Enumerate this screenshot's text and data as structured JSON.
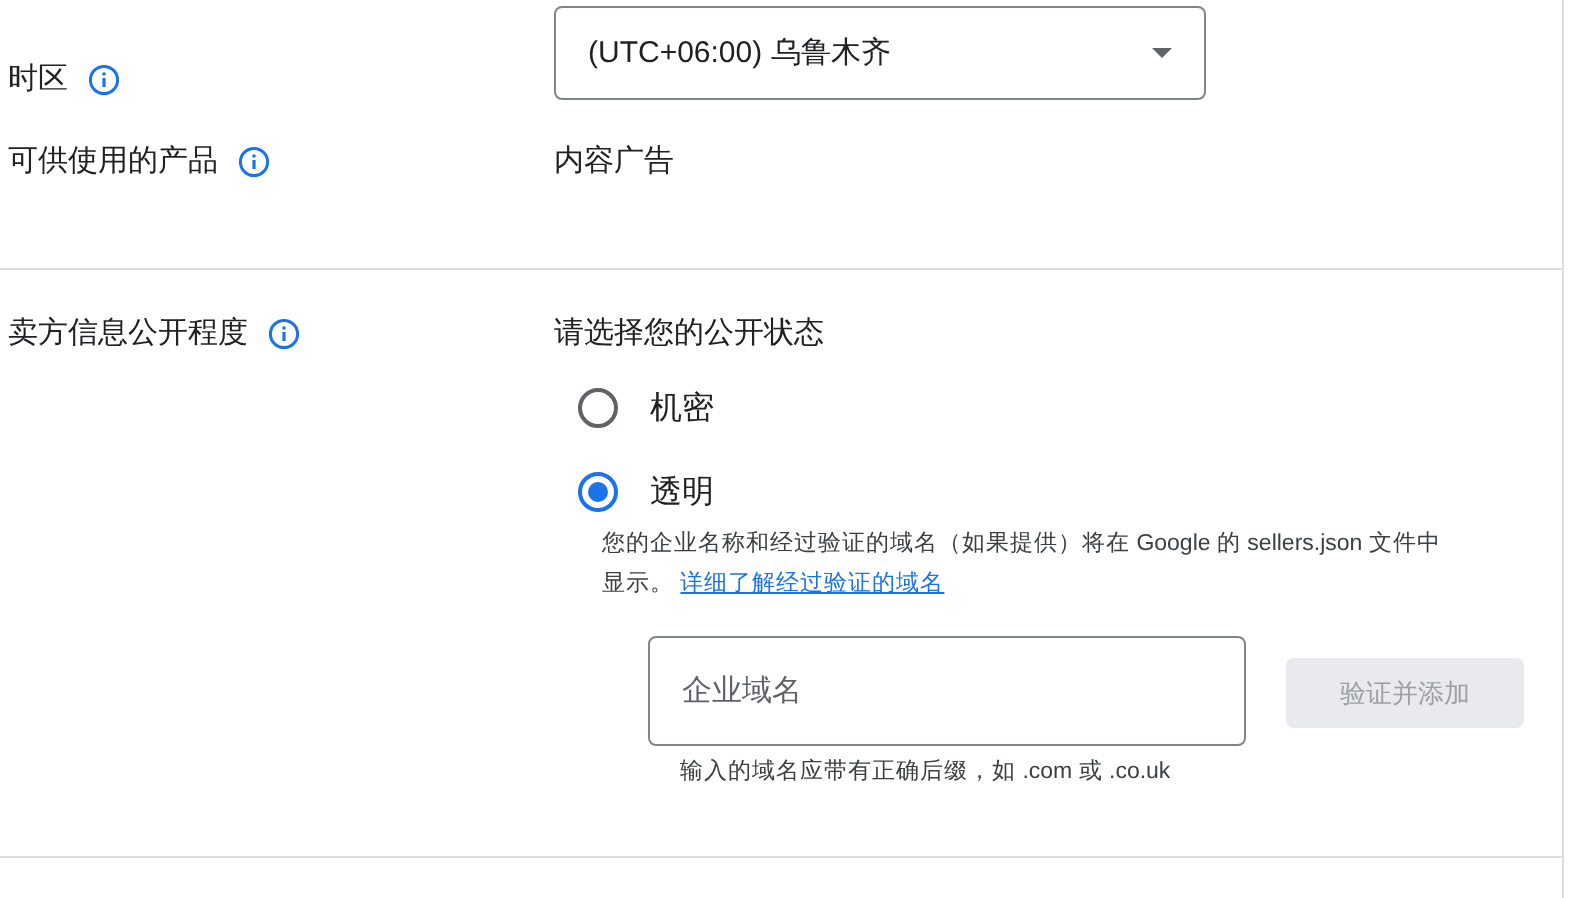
{
  "rows": [
    {
      "kind": "select",
      "label": "时区",
      "select": {
        "value": "(UTC+06:00) 乌鲁木齐"
      }
    },
    {
      "kind": "text",
      "label": "可供使用的产品",
      "value": "内容广告"
    },
    {
      "kind": "visibility",
      "label": "卖方信息公开程度",
      "prompt": "请选择您的公开状态",
      "options": [
        {
          "label": "机密",
          "selected": false
        },
        {
          "label": "透明",
          "selected": true
        }
      ],
      "description": "您的企业名称和经过验证的域名（如果提供）将在 Google 的 sellers.json 文件中显示。",
      "link": "详细了解经过验证的域名",
      "field": {
        "placeholder": "企业域名",
        "hint": "输入的域名应带有正确后缀，如 .com 或 .co.uk"
      },
      "button": {
        "label": "验证并添加",
        "disabled": true
      }
    }
  ]
}
